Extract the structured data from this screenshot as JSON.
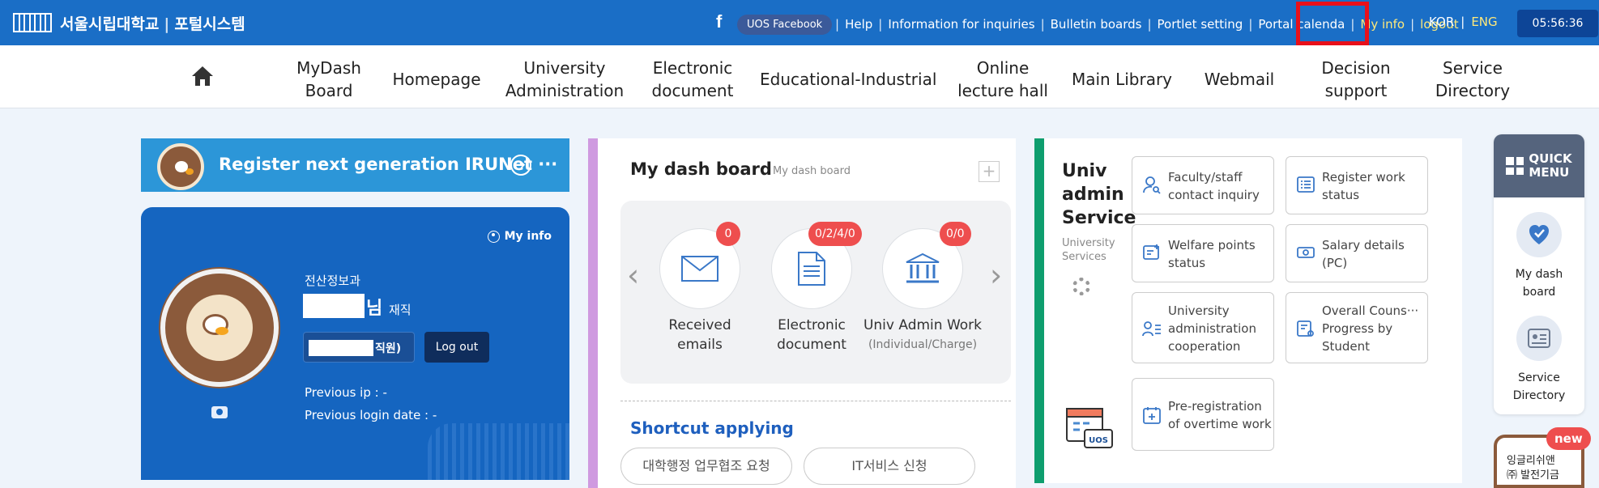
{
  "header": {
    "logo_school": "서울시립대학교",
    "logo_sep": "|",
    "logo_system": "포털시스템",
    "facebook_icon": "f",
    "facebook_label": "UOS Facebook",
    "links": [
      "Help",
      "Information for inquiries",
      "Bulletin boards",
      "Portlet setting",
      "Portal calenda",
      "My info",
      "logout"
    ],
    "highlighted_link": "My info",
    "lang_kor": "KOR",
    "lang_sep": "|",
    "lang_eng": "ENG",
    "clock": "05:56:36",
    "accent_color": "#1a6ec6",
    "highlight_color": "#e8101a"
  },
  "nav": {
    "home_icon": "home-icon",
    "items": [
      {
        "line1": "MyDash",
        "line2": "Board"
      },
      {
        "line1": "Homepage",
        "line2": ""
      },
      {
        "line1": "University",
        "line2": "Administration"
      },
      {
        "line1": "Electronic",
        "line2": "document"
      },
      {
        "line1": "Educational-Industrial",
        "line2": ""
      },
      {
        "line1": "Online",
        "line2": "lecture hall"
      },
      {
        "line1": "Main Library",
        "line2": ""
      },
      {
        "line1": "Webmail",
        "line2": ""
      },
      {
        "line1": "Decision",
        "line2": "support"
      },
      {
        "line1": "Service",
        "line2": "Directory"
      }
    ]
  },
  "register_banner": {
    "text": "Register next generation IRUNet ···",
    "arrow": "➔"
  },
  "profile": {
    "myinfo_label": "My info",
    "department": "전산정보과",
    "name_suffix": "님",
    "status": "재직",
    "role": "직원)",
    "logout_label": "Log out",
    "prev_ip": "Previous ip : -",
    "prev_login": "Previous login date : -"
  },
  "dashboard": {
    "title": "My dash board",
    "subtitle": "My dash board",
    "plus": "+",
    "prev_arrow": "‹",
    "next_arrow": "›",
    "items": [
      {
        "label1": "Received",
        "label2": "emails",
        "badge": "0",
        "icon": "mail-icon"
      },
      {
        "label1": "Electronic",
        "label2": "document",
        "badge": "0/2/4/0",
        "icon": "document-icon"
      },
      {
        "label1": "Univ Admin Work",
        "label2": "(Individual/Charge)",
        "badge": "0/0",
        "icon": "bank-icon"
      }
    ],
    "shortcut_title": "Shortcut applying",
    "shortcuts": [
      "대학행정 업무협조 요청",
      "IT서비스 신청"
    ]
  },
  "univ_admin": {
    "title": "Univ admin Service",
    "subtitle": "University Services",
    "services": [
      {
        "label": "Faculty/staff contact inquiry",
        "icon": "person-search-icon"
      },
      {
        "label": "Register work status",
        "icon": "list-icon"
      },
      {
        "label": "Welfare points status",
        "icon": "points-icon"
      },
      {
        "label": "Salary details (PC)",
        "icon": "money-icon"
      },
      {
        "label": "University administration cooperation",
        "icon": "people-list-icon"
      },
      {
        "label": "Overall Couns··· Progress by Student",
        "icon": "counsel-icon"
      },
      {
        "label": "Pre-registration of overtime work",
        "icon": "calendar-plus-icon"
      }
    ],
    "calendar_badge": "UOS"
  },
  "quick_menu": {
    "title_line1": "QUICK",
    "title_line2": "MENU",
    "items": [
      {
        "line1": "My dash",
        "line2": "board",
        "icon": "heart-shield-icon"
      },
      {
        "line1": "Service",
        "line2": "Directory",
        "icon": "directory-icon"
      }
    ],
    "promo_new": "new",
    "promo_line1": "잉글리쉬앤",
    "promo_line2": "㈜ 발전기금"
  }
}
